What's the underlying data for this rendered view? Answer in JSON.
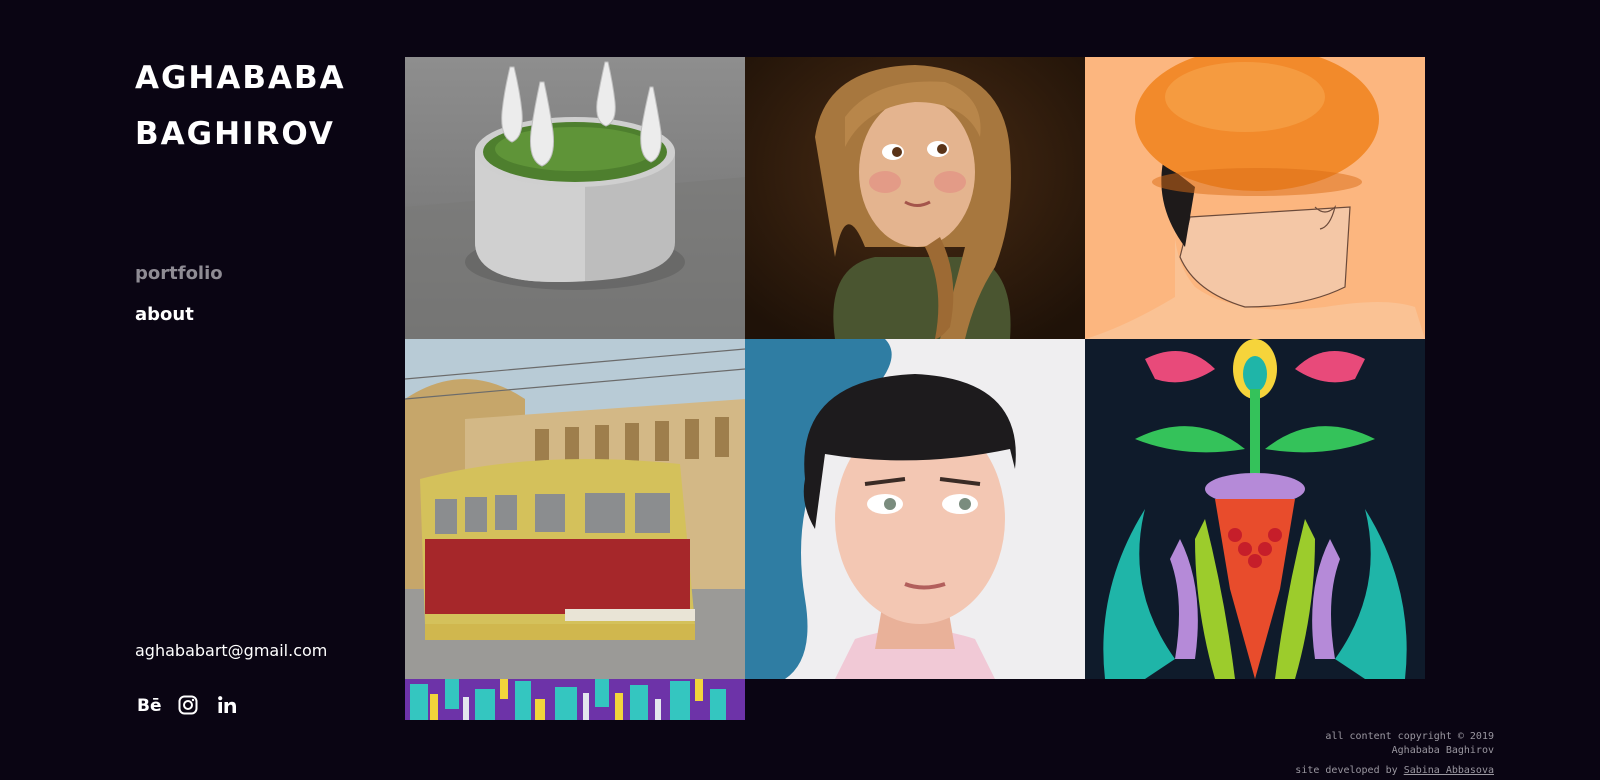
{
  "logo": {
    "line1": "AGHABABA",
    "line2": "BAGHIROV"
  },
  "nav": {
    "items": [
      {
        "label": "portfolio",
        "active": true
      },
      {
        "label": "about",
        "active": false
      }
    ]
  },
  "contact": {
    "email": "aghababart@gmail.com"
  },
  "socials": [
    {
      "icon": "behance-icon"
    },
    {
      "icon": "instagram-icon"
    },
    {
      "icon": "linkedin-icon"
    }
  ],
  "gallery": {
    "tiles": [
      {
        "icon": "artwork-white-vases-in-grass-pot"
      },
      {
        "icon": "artwork-girl-with-braid-portrait"
      },
      {
        "icon": "artwork-orange-head-man"
      },
      {
        "icon": "artwork-tram-street-scene"
      },
      {
        "icon": "artwork-boy-bowl-cut-portrait"
      },
      {
        "icon": "artwork-folk-ornament-vase-fish"
      },
      {
        "icon": "artwork-colorful-blocks-pattern"
      }
    ]
  },
  "footer": {
    "copyright_line1": "all content copyright © 2019",
    "copyright_line2": "Aghababa Baghirov",
    "dev_prefix": "site developed by",
    "dev_name": "Sabina Abbasova"
  },
  "colors": {
    "background": "#0a0513",
    "text": "#ffffff",
    "nav_active": "#8f8c94",
    "footer": "#9a97a0"
  }
}
